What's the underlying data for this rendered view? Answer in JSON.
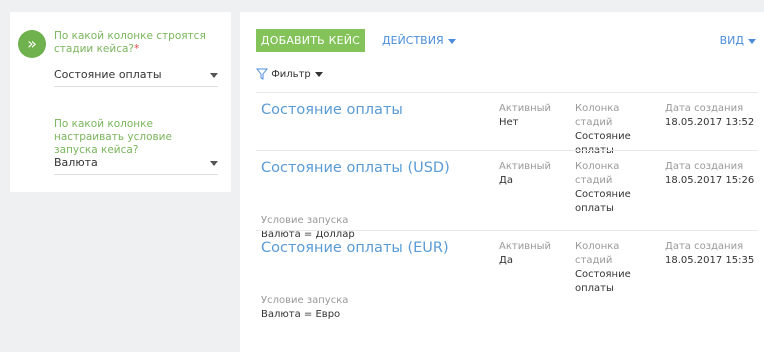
{
  "left": {
    "step_icon": "»",
    "question1": "По какой колонке строятся стадии кейса?",
    "required_mark": "*",
    "select1_value": "Состояние оплаты",
    "question2": "По какой колонке настраивать условие запуска кейса?",
    "select2_value": "Валюта"
  },
  "toolbar": {
    "add_case": "ДОБАВИТЬ КЕЙС",
    "actions": "ДЕЙСТВИЯ",
    "view": "ВИД",
    "filter": "Фильтр"
  },
  "records": [
    {
      "title": "Состояние оплаты",
      "active_label": "Активный",
      "active_value": "Нет",
      "stage_label": "Колонка стадий",
      "stage_value": "Состояние оплаты",
      "date_label": "Дата создания",
      "date_value": "18.05.2017 13:52"
    },
    {
      "title": "Состояние оплаты (USD)",
      "active_label": "Активный",
      "active_value": "Да",
      "stage_label": "Колонка стадий",
      "stage_value": "Состояние оплаты",
      "date_label": "Дата создания",
      "date_value": "18.05.2017 15:26",
      "cond_label": "Условие запуска",
      "cond_value": "Валюта = Доллар"
    },
    {
      "title": "Состояние оплаты (EUR)",
      "active_label": "Активный",
      "active_value": "Да",
      "stage_label": "Колонка стадий",
      "stage_value": "Состояние оплаты",
      "date_label": "Дата создания",
      "date_value": "18.05.2017 15:35",
      "cond_label": "Условие запуска",
      "cond_value": "Валюта = Евро"
    }
  ]
}
